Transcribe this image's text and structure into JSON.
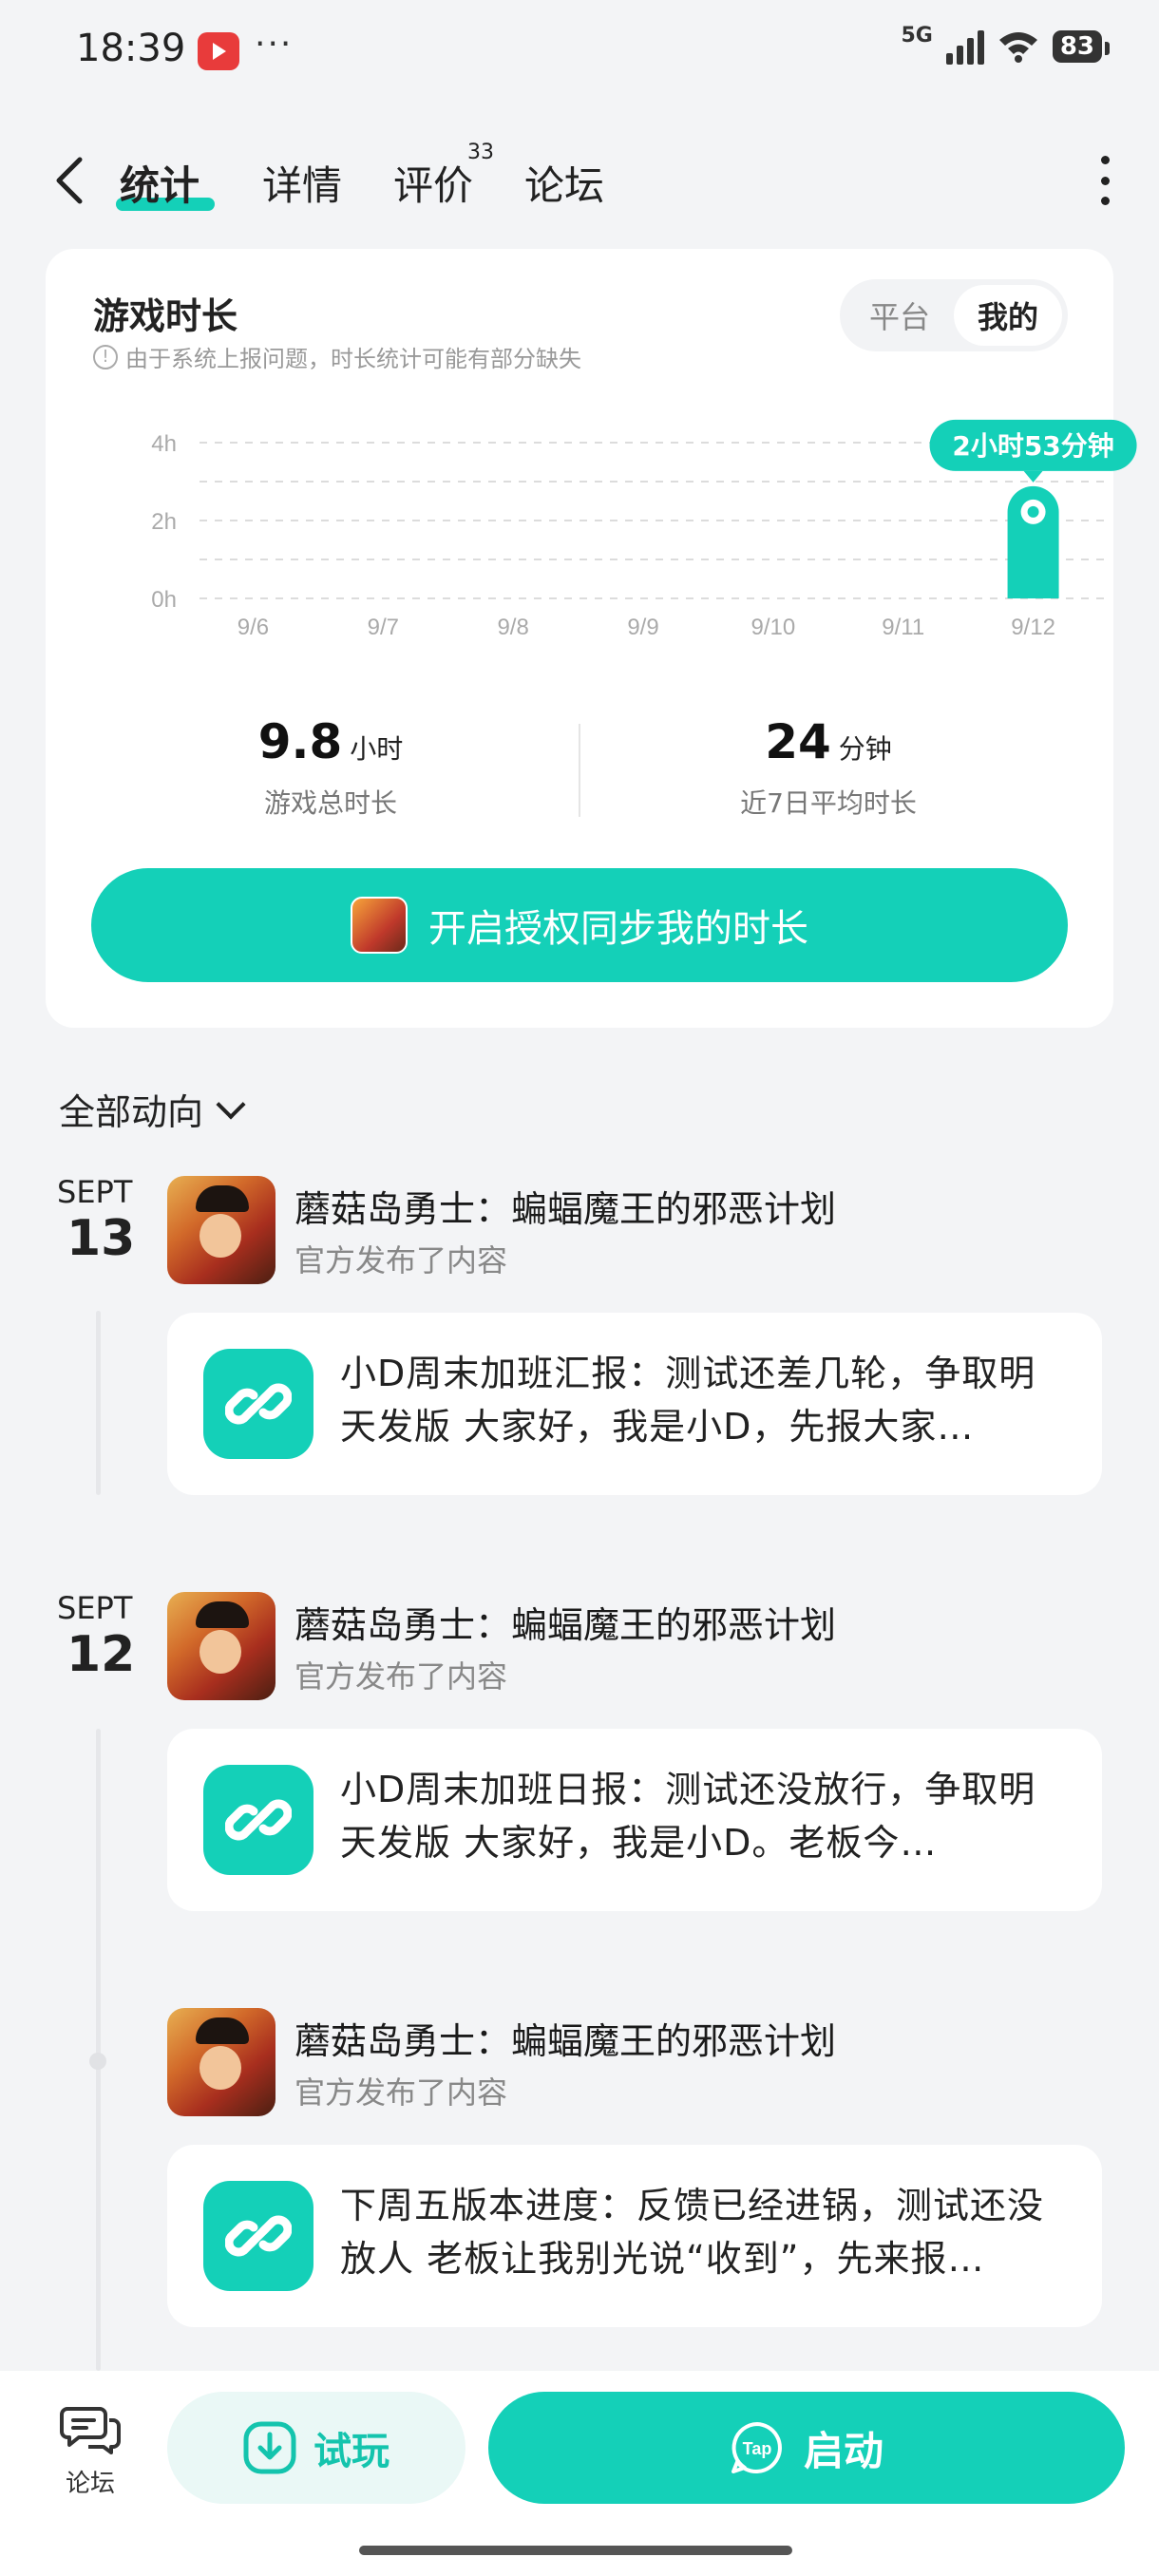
{
  "status_bar": {
    "time": "18:39",
    "more": "···",
    "network": "5G",
    "battery": "83"
  },
  "nav": {
    "tabs": [
      {
        "label": "统计"
      },
      {
        "label": "详情"
      },
      {
        "label": "评价"
      },
      {
        "label": "论坛"
      }
    ],
    "review_count": "33"
  },
  "stats": {
    "title": "游戏时长",
    "note": "由于系统上报问题，时长统计可能有部分缺失",
    "segment": [
      {
        "label": "平台"
      },
      {
        "label": "我的"
      }
    ],
    "total_value": "9.8",
    "total_unit": "小时",
    "total_label": "游戏总时长",
    "avg_value": "24",
    "avg_unit": "分钟",
    "avg_label": "近7日平均时长",
    "sync_button": "开启授权同步我的时长"
  },
  "chart_data": {
    "type": "bar",
    "categories": [
      "9/6",
      "9/7",
      "9/8",
      "9/9",
      "9/10",
      "9/11",
      "9/12"
    ],
    "values": [
      0,
      0,
      0,
      0,
      0,
      0,
      2.88
    ],
    "value_labels": [
      "",
      "",
      "",
      "",
      "",
      "",
      "2小时53分钟"
    ],
    "y_ticks": [
      "0h",
      "2h",
      "4h"
    ],
    "ylim": [
      0,
      4
    ],
    "grid": true,
    "colors": {
      "bar": "#14d0b8"
    }
  },
  "feed": {
    "filter_label": "全部动向",
    "groups": [
      {
        "month": "SEPT",
        "day": "13",
        "posts": [
          {
            "title": "蘑菇岛勇士：蝙蝠魔王的邪恶计划",
            "subtitle": "官方发布了内容",
            "text": "小D周末加班汇报：测试还差几轮，争取明天发版 大家好，我是小D，先报大家…"
          }
        ]
      },
      {
        "month": "SEPT",
        "day": "12",
        "posts": [
          {
            "title": "蘑菇岛勇士：蝙蝠魔王的邪恶计划",
            "subtitle": "官方发布了内容",
            "text": "小D周末加班日报：测试还没放行，争取明天发版 大家好，我是小D。老板今…"
          },
          {
            "title": "蘑菇岛勇士：蝙蝠魔王的邪恶计划",
            "subtitle": "官方发布了内容",
            "text": "下周五版本进度：反馈已经进锅，测试还没放人 老板让我别光说“收到”，先来报…"
          }
        ]
      }
    ]
  },
  "bottom": {
    "forum_label": "论坛",
    "try_label": "试玩",
    "launch_label": "启动",
    "launch_icon_text": "Tap"
  },
  "colors": {
    "accent": "#14d0b8",
    "background": "#f3f4f6"
  }
}
